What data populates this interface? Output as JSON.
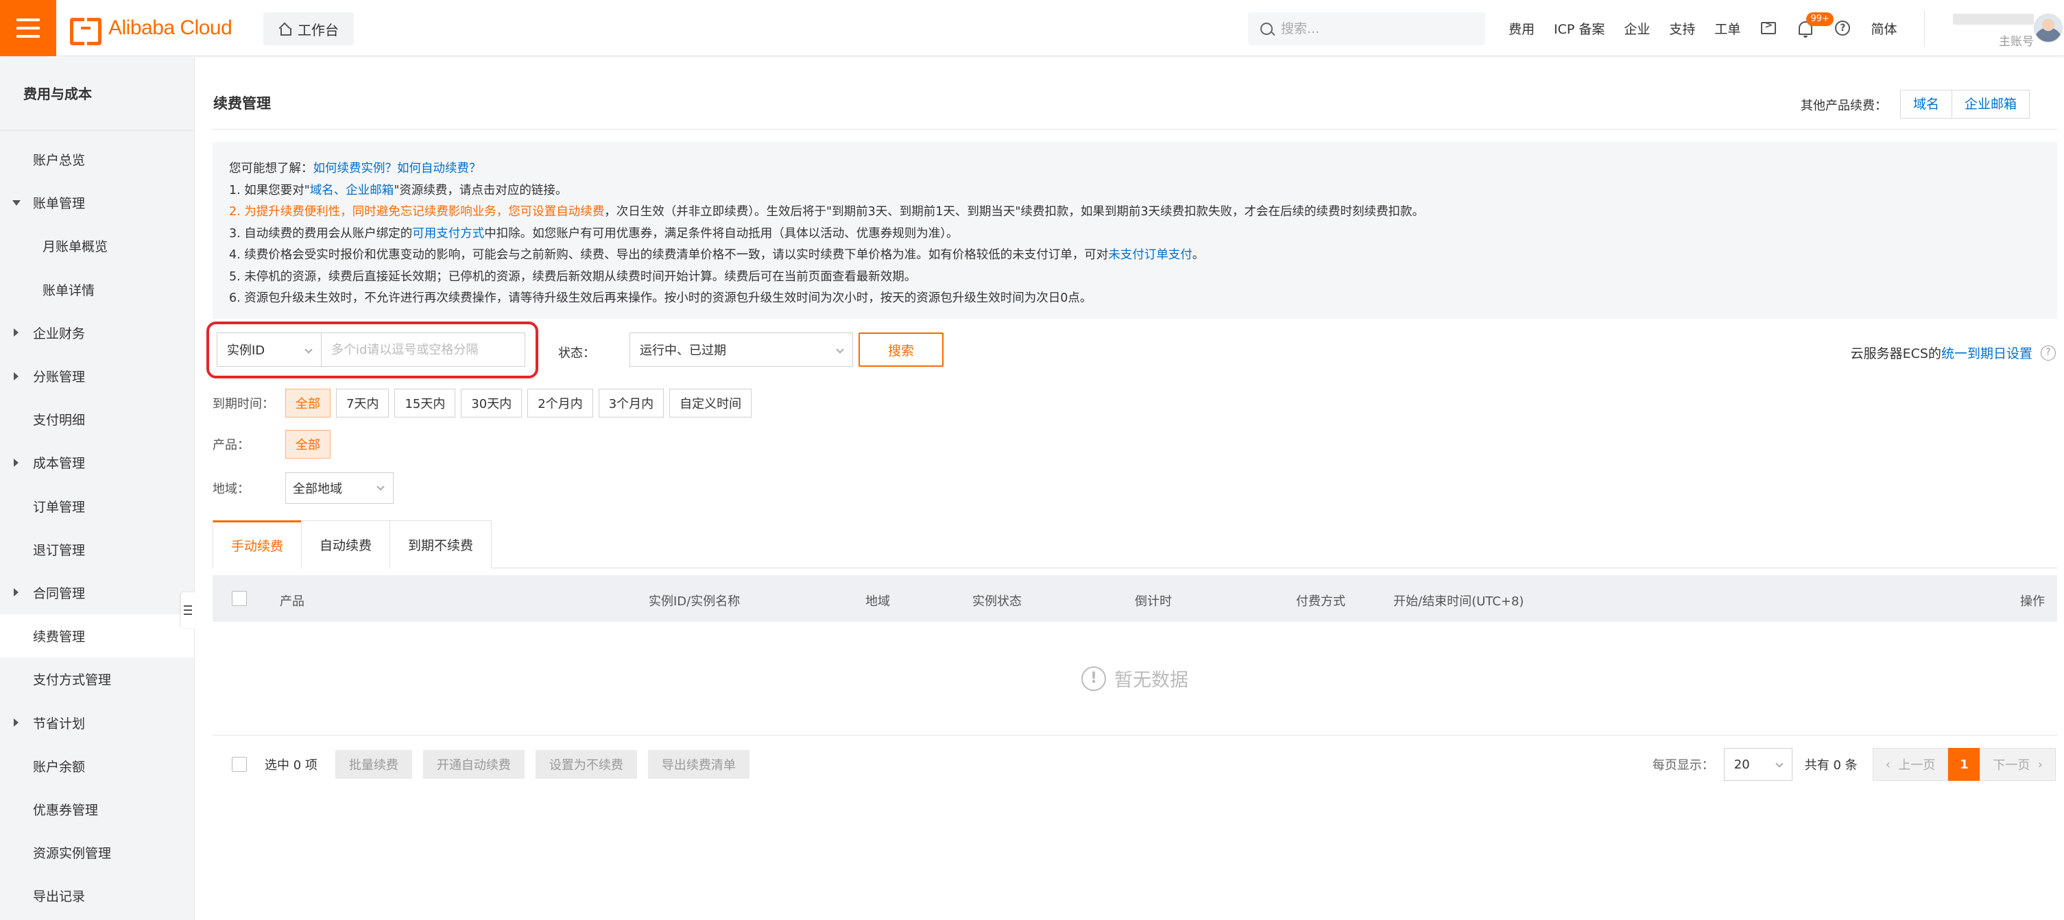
{
  "header": {
    "brand": "Alibaba Cloud",
    "workbench": "工作台",
    "search_placeholder": "搜索...",
    "links": [
      "费用",
      "ICP 备案",
      "企业",
      "支持",
      "工单"
    ],
    "notification_badge": "99+",
    "language": "简体",
    "account_role": "主账号",
    "accent_color": "#ff6a00"
  },
  "sidebar": {
    "title": "费用与成本",
    "items": [
      {
        "label": "账户总览"
      },
      {
        "label": "账单管理"
      },
      {
        "label": "月账单概览"
      },
      {
        "label": "账单详情"
      },
      {
        "label": "企业财务"
      },
      {
        "label": "分账管理"
      },
      {
        "label": "支付明细"
      },
      {
        "label": "成本管理"
      },
      {
        "label": "订单管理"
      },
      {
        "label": "退订管理"
      },
      {
        "label": "合同管理"
      },
      {
        "label": "续费管理"
      },
      {
        "label": "支付方式管理"
      },
      {
        "label": "节省计划"
      },
      {
        "label": "账户余额"
      },
      {
        "label": "优惠券管理"
      },
      {
        "label": "资源实例管理"
      },
      {
        "label": "导出记录"
      }
    ]
  },
  "page": {
    "title": "续费管理",
    "other_renew_label": "其他产品续费：",
    "other_renew_buttons": [
      "域名",
      "企业邮箱"
    ]
  },
  "notice": {
    "intro": "您可能想了解：",
    "intro_links": "如何续费实例？如何自动续费？",
    "l1a": "1. 如果您要对\"",
    "l1link": "域名、企业邮箱",
    "l1b": "\"资源续费，请点击对应的链接。",
    "l2a": "2. 为提升续费便利性，同时避免忘记续费影响业务，您可设置自动续费",
    "l2b": "，次日生效（并非立即续费）。生效后将于\"到期前3天、到期前1天、到期当天\"续费扣款，如果到期前3天续费扣款失败，才会在后续的续费时刻续费扣款。",
    "l3a": "3. 自动续费的费用会从账户绑定的",
    "l3link": "可用支付方式",
    "l3b": "中扣除。如您账户有可用优惠券，满足条件将自动抵用（具体以活动、优惠券规则为准）。",
    "l4a": "4. 续费价格会受实时报价和优惠变动的影响，可能会与之前新购、续费、导出的续费清单价格不一致，请以实时续费下单价格为准。如有价格较低的未支付订单，可对",
    "l4link": "未支付订单支付",
    "l4b": "。",
    "l5": "5. 未停机的资源，续费后直接延长效期；已停机的资源，续费后新效期从续费时间开始计算。续费后可在当前页面查看最新效期。",
    "l6": "6. 资源包升级未生效时，不允许进行再次续费操作，请等待升级生效后再来操作。按小时的资源包升级生效时间为次小时，按天的资源包升级生效时间为次日0点。"
  },
  "filters": {
    "id_type": "实例ID",
    "id_placeholder": "多个id请以逗号或空格分隔",
    "status_label": "状态：",
    "status_value": "运行中、已过期",
    "search_button": "搜索",
    "ecs_text": "云服务器ECS的",
    "ecs_link": "统一到期日设置",
    "expire_label": "到期时间：",
    "expire_options": [
      "全部",
      "7天内",
      "15天内",
      "30天内",
      "2个月内",
      "3个月内",
      "自定义时间"
    ],
    "product_label": "产品：",
    "product_option": "全部",
    "region_label": "地域：",
    "region_value": "全部地域"
  },
  "tabs": [
    "手动续费",
    "自动续费",
    "到期不续费"
  ],
  "table": {
    "columns": [
      "产品",
      "实例ID/实例名称",
      "地域",
      "实例状态",
      "倒计时",
      "付费方式",
      "开始/结束时间(UTC+8)",
      "操作"
    ],
    "empty_text": "暂无数据"
  },
  "bottom": {
    "selected": "选中 0 项",
    "actions": [
      "批量续费",
      "开通自动续费",
      "设置为不续费",
      "导出续费清单"
    ],
    "per_page_label": "每页显示：",
    "per_page": "20",
    "total": "共有 0 条",
    "prev": "上一页",
    "current_page": "1",
    "next": "下一页"
  }
}
